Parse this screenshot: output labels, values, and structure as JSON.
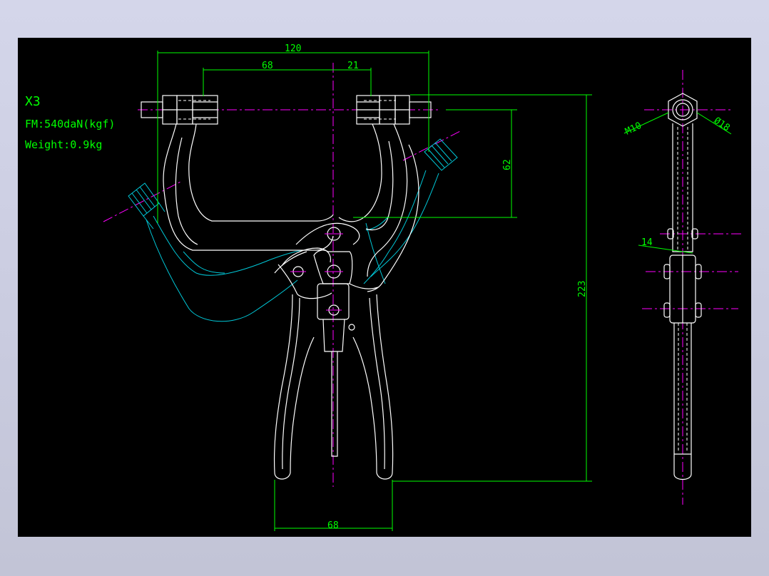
{
  "notes": {
    "model": "X3",
    "force": "FM:540daN(kgf)",
    "weight": "Weight:0.9kg"
  },
  "dimensions": {
    "overall_width": "120",
    "pivot_offset": "68",
    "jaw_offset": "21",
    "jaw_height": "62",
    "overall_height": "223",
    "handle_spread": "68",
    "thread": "M10",
    "hex_dia": "Ø18",
    "thickness": "14"
  },
  "colors": {
    "background": "#000000",
    "geometry": "#ffffff",
    "dimension": "#00ff00",
    "centerline": "#ff00ff",
    "alternate_position": "#00c8d8"
  }
}
